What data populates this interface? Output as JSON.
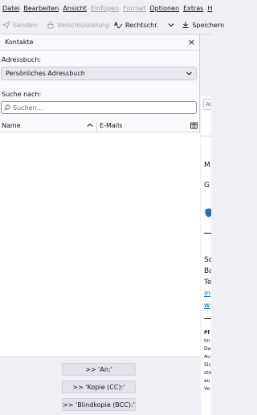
{
  "menubar": {
    "items": [
      {
        "label": "Datei",
        "enabled": true
      },
      {
        "label": "Bearbeiten",
        "enabled": true
      },
      {
        "label": "Ansicht",
        "enabled": true
      },
      {
        "label": "Einfügen",
        "enabled": false
      },
      {
        "label": "Format",
        "enabled": false
      },
      {
        "label": "Optionen",
        "enabled": true
      },
      {
        "label": "Extras",
        "enabled": true
      },
      {
        "label": "H",
        "enabled": true
      }
    ]
  },
  "toolbar": {
    "send": "Senden",
    "encryption": "Verschlüsselung",
    "spelling": "Rechtschr.",
    "save": "Speichern"
  },
  "sidebar": {
    "title": "Kontakte",
    "addressbook_label": "Adressbuch:",
    "addressbook_value": "Persönliches Adressbuch",
    "search_label": "Suche nach:",
    "search_placeholder": "Suchen...",
    "col_name": "Name",
    "col_email": "E-Mails",
    "btn_to": ">> 'An:'",
    "btn_cc": ">> 'Kopie (CC):'",
    "btn_bcc": ">> 'Blindkopie (BCC):'"
  },
  "compose": {
    "field_fragment": "Al",
    "body_fragments": {
      "m": "M",
      "g": "G",
      "s": "Sc",
      "b": "Ba",
      "t": "Te",
      "link1": "in",
      "link2": "w"
    },
    "small_fragments": {
      "pf": "Pf",
      "im": "Im",
      "da": "Da",
      "au": "Au",
      "si": "Sic",
      "st": "sto",
      "au2": "au",
      "vo": "Vo"
    }
  },
  "colors": {
    "link": "#0b61c5",
    "chrome": "#f0f0f4",
    "panel": "#f9f9fb"
  }
}
